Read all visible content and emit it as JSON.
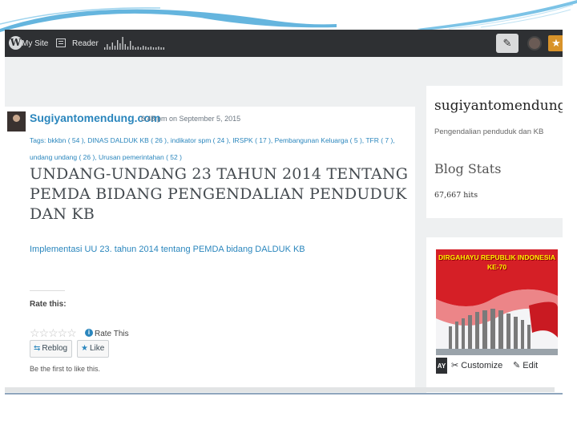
{
  "admin_bar": {
    "my_site_label": "My Site",
    "reader_label": "Reader",
    "stats_sparkline": [
      2,
      5,
      3,
      7,
      4,
      9,
      6,
      12,
      5,
      3,
      8,
      4,
      2,
      3,
      2,
      4,
      3,
      2,
      3,
      2,
      2,
      3,
      2,
      2
    ],
    "icons": [
      "wordpress-icon",
      "my-site-icon",
      "reader-icon",
      "write-icon",
      "avatar",
      "notifications-icon"
    ],
    "notifications_color": "#d8932a"
  },
  "post": {
    "site_name": "Sugiyantomendung.com",
    "timestamp": "6:48 pm on September 5, 2015",
    "tags_line1": "Tags: bkkbn ( 54 ), DINAS DALDUK KB ( 26 ), indikator spm ( 24 ), IRSPK ( 17 ), Pembangunan Keluarga ( 5 ), TFR ( 7 ),",
    "tags_line2": "undang undang ( 26 ), Urusan pemerintahan ( 52 )",
    "title": "UNDANG-UNDANG 23 TAHUN 2014 TENTANG PEMDA BIDANG PENGENDALIAN PENDUDUK DAN KB",
    "excerpt": "Implementasi UU 23. tahun 2014 tentang PEMDA bidang DALDUK KB",
    "rate_label": "Rate this:",
    "rating_stars": "☆☆☆☆☆",
    "rate_this": "Rate This",
    "reblog_label": "Reblog",
    "like_label": "Like",
    "like_note": "Be the first to like this.",
    "link_color": "#2a86bd"
  },
  "sidebar": {
    "blog_title": "sugiyantomendung.c",
    "tagline": "Pengendalian penduduk dan KB",
    "stats_title": "Blog Stats",
    "hits": "67,667 hits",
    "banner_text_line1": "DIRGAHAYU REPUBLIK INDONESIA",
    "banner_text_line2": "KE-70",
    "ay_label": "AY",
    "customize_label": "Customize",
    "edit_label": "Edit"
  }
}
